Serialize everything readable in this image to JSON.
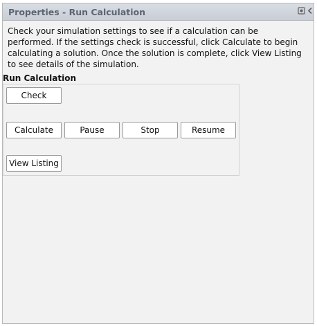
{
  "window": {
    "title": "Properties - Run Calculation",
    "icons": [
      "pin-icon",
      "collapse-chevron-icon"
    ]
  },
  "description": "Check your simulation settings to see if a calculation can be performed. If the settings check is successful, click Calculate to begin calculating a solution. Once the solution is complete, click View Listing to see details of the simulation.",
  "section": {
    "label": "Run Calculation"
  },
  "buttons": {
    "check": "Check",
    "calculate": "Calculate",
    "pause": "Pause",
    "stop": "Stop",
    "resume": "Resume",
    "view_listing": "View Listing"
  }
}
